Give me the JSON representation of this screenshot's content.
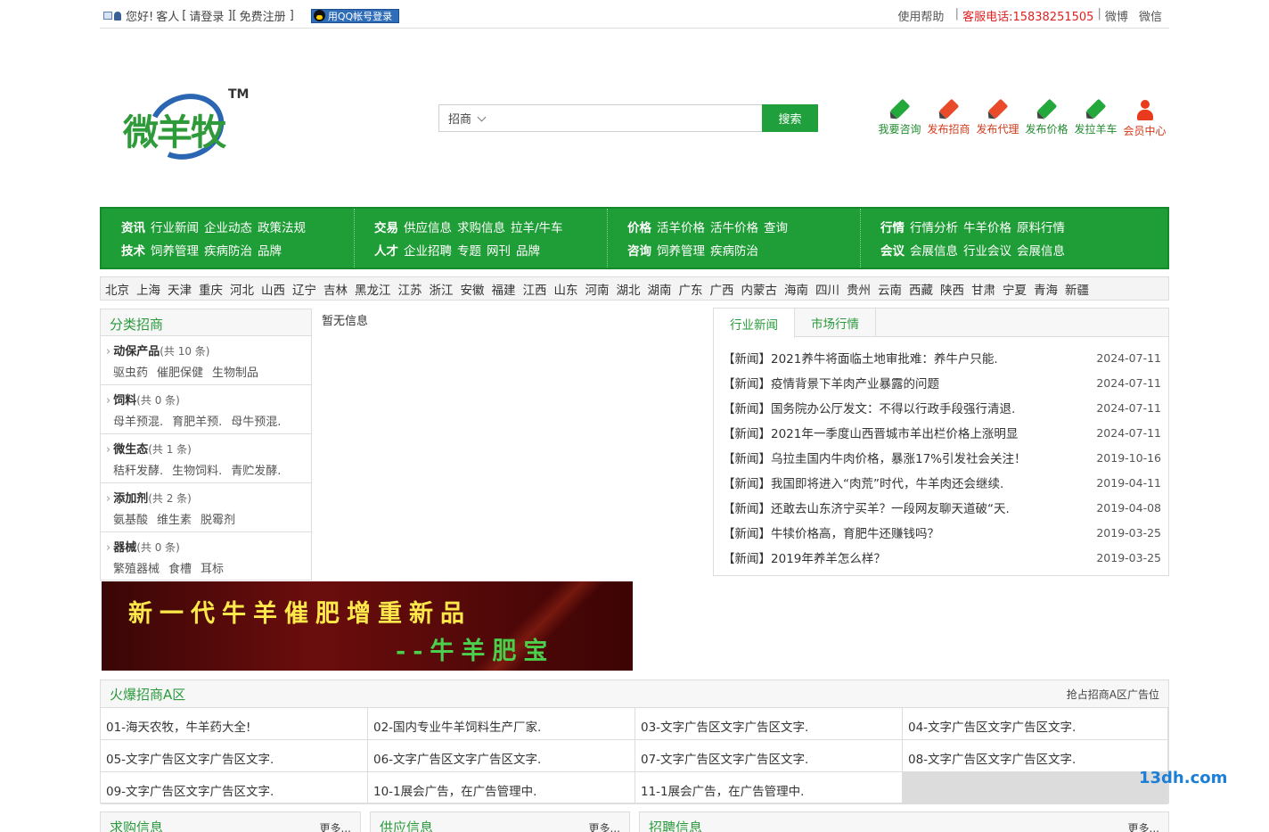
{
  "topbar": {
    "greeting": "您好!",
    "guest": "客人",
    "login": "请登录",
    "register": "免费注册",
    "qq_login": "用QQ帐号登录",
    "help": "使用帮助",
    "hotline_label": "客服电话:15838251505",
    "weibo": "微博",
    "weixin": "微信"
  },
  "logo": {
    "text": "微羊牧",
    "tm": "TM"
  },
  "search": {
    "category": "招商",
    "button": "搜索"
  },
  "actions": [
    {
      "label": "我要咨询",
      "icon": "pen-icon",
      "color": "green"
    },
    {
      "label": "发布招商",
      "icon": "pen-icon",
      "color": "red"
    },
    {
      "label": "发布代理",
      "icon": "pen-icon",
      "color": "red"
    },
    {
      "label": "发布价格",
      "icon": "pen-icon",
      "color": "green"
    },
    {
      "label": "发拉羊车",
      "icon": "pen-icon",
      "color": "green"
    },
    {
      "label": "会员中心",
      "icon": "user-icon",
      "color": "red"
    }
  ],
  "nav": [
    {
      "rows": [
        {
          "head": "资讯",
          "items": [
            "行业新闻",
            "企业动态",
            "政策法规"
          ]
        },
        {
          "head": "技术",
          "items": [
            "饲养管理",
            "疾病防治",
            "品牌"
          ]
        }
      ]
    },
    {
      "rows": [
        {
          "head": "交易",
          "items": [
            "供应信息",
            "求购信息",
            "拉羊/牛车"
          ]
        },
        {
          "head": "人才",
          "items": [
            "企业招聘",
            "专题",
            "网刊",
            "品牌"
          ]
        }
      ]
    },
    {
      "rows": [
        {
          "head": "价格",
          "items": [
            "活羊价格",
            "活牛价格",
            "查询"
          ]
        },
        {
          "head": "咨询",
          "items": [
            "饲养管理",
            "疾病防治"
          ]
        }
      ]
    },
    {
      "rows": [
        {
          "head": "行情",
          "items": [
            "行情分析",
            "牛羊价格",
            "原料行情"
          ]
        },
        {
          "head": "会议",
          "items": [
            "会展信息",
            "行业会议",
            "会展信息"
          ]
        }
      ]
    }
  ],
  "cities": [
    "北京",
    "上海",
    "天津",
    "重庆",
    "河北",
    "山西",
    "辽宁",
    "吉林",
    "黑龙江",
    "江苏",
    "浙江",
    "安徽",
    "福建",
    "江西",
    "山东",
    "河南",
    "湖北",
    "湖南",
    "广东",
    "广西",
    "内蒙古",
    "海南",
    "四川",
    "贵州",
    "云南",
    "西藏",
    "陕西",
    "甘肃",
    "宁夏",
    "青海",
    "新疆"
  ],
  "categories": {
    "title": "分类招商",
    "items": [
      {
        "name": "动保产品",
        "count": "(共 10 条)",
        "subs": [
          "驱虫药",
          "催肥保健",
          "生物制品"
        ]
      },
      {
        "name": "饲料",
        "count": "(共 0 条)",
        "subs": [
          "母羊预混.",
          "育肥羊预.",
          "母牛预混."
        ]
      },
      {
        "name": "微生态",
        "count": "(共 1 条)",
        "subs": [
          "秸秆发酵.",
          "生物饲料.",
          "青贮发酵."
        ]
      },
      {
        "name": "添加剂",
        "count": "(共 2 条)",
        "subs": [
          "氨基酸",
          "维生素",
          "脱霉剂"
        ]
      },
      {
        "name": "器械",
        "count": "(共 0 条)",
        "subs": [
          "繁殖器械",
          "食槽",
          "耳标"
        ]
      }
    ]
  },
  "middle": {
    "empty_text": "暂无信息"
  },
  "news": {
    "tabs": [
      "行业新闻",
      "市场行情"
    ],
    "items": [
      {
        "title": "【新闻】2021养牛将面临土地审批难：养牛户只能.",
        "date": "2024-07-11"
      },
      {
        "title": "【新闻】疫情背景下羊肉产业暴露的问题",
        "date": "2024-07-11"
      },
      {
        "title": "【新闻】国务院办公厅发文：不得以行政手段强行清退.",
        "date": "2024-07-11"
      },
      {
        "title": "【新闻】2021年一季度山西晋城市羊出栏价格上涨明显",
        "date": "2024-07-11"
      },
      {
        "title": "【新闻】乌拉圭国内牛肉价格，暴涨17%引发社会关注！",
        "date": "2019-10-16"
      },
      {
        "title": "【新闻】我国即将进入“肉荒”时代，牛羊肉还会继续.",
        "date": "2019-04-11"
      },
      {
        "title": "【新闻】还敢去山东济宁买羊？一段网友聊天道破“天.",
        "date": "2019-04-08"
      },
      {
        "title": "【新闻】牛犊价格高，育肥牛还赚钱吗？",
        "date": "2019-03-25"
      },
      {
        "title": "【新闻】2019年养羊怎么样？",
        "date": "2019-03-25"
      }
    ]
  },
  "banner": {
    "line1": "新一代牛羊催肥增重新品",
    "line2": "--牛羊肥宝"
  },
  "adzone": {
    "title": "火爆招商A区",
    "more": "抢占招商A区广告位",
    "cells": [
      "01-海天农牧，牛羊药大全!",
      "02-国内专业牛羊饲料生产厂家.",
      "03-文字广告区文字广告区文字.",
      "04-文字广告区文字广告区文字.",
      "05-文字广告区文字广告区文字.",
      "06-文字广告区文字广告区文字.",
      "07-文字广告区文字广告区文字.",
      "08-文字广告区文字广告区文字.",
      "09-文字广告区文字广告区文字.",
      "10-1展会广告，在广告管理中.",
      "11-1展会广告，在广告管理中.",
      ""
    ]
  },
  "bottom": [
    {
      "title": "求购信息",
      "more": "更多..."
    },
    {
      "title": "供应信息",
      "more": "更多..."
    },
    {
      "title": "招聘信息",
      "more": "更多..."
    }
  ],
  "watermark": "13dh.com"
}
